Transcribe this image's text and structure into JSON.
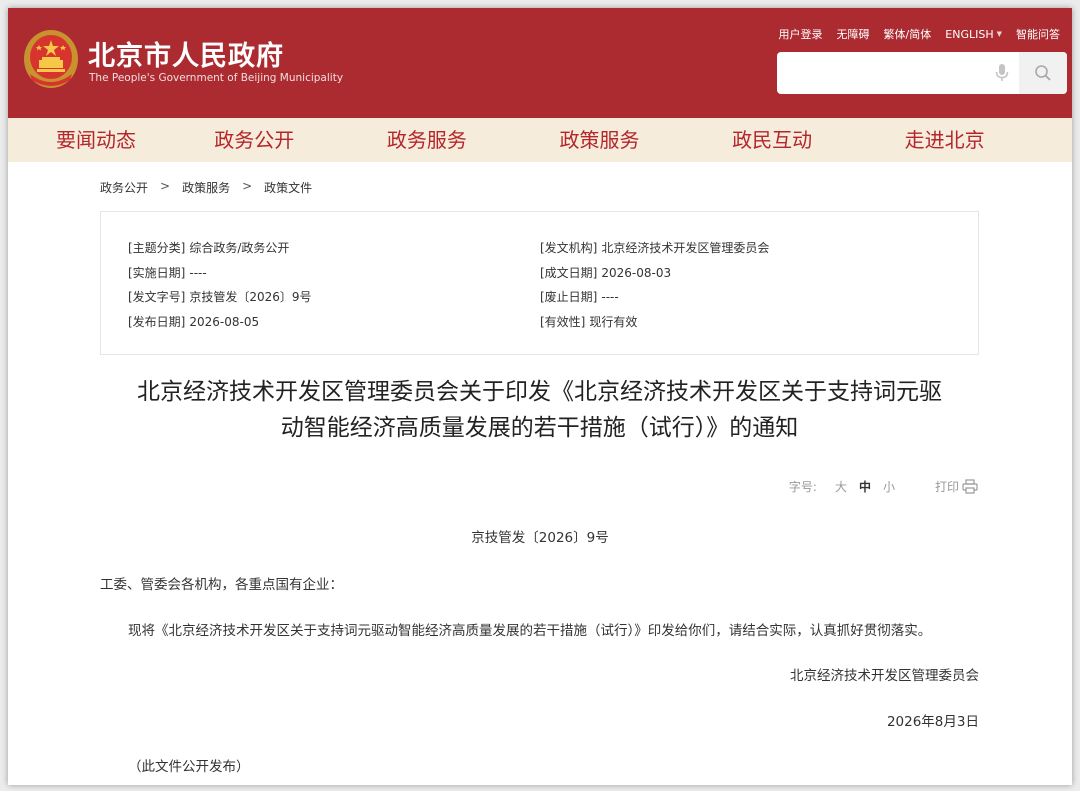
{
  "header": {
    "title": "北京市人民政府",
    "subtitle": "The People's Government of Beijing Municipality",
    "links": [
      "用户登录",
      "无障碍",
      "繁体/简体",
      "ENGLISH",
      "智能问答"
    ],
    "search_placeholder": ""
  },
  "nav": [
    "要闻动态",
    "政务公开",
    "政务服务",
    "政策服务",
    "政民互动",
    "走进北京"
  ],
  "breadcrumb": [
    "政务公开",
    "政策服务",
    "政策文件"
  ],
  "info": {
    "topic_k": "[主题分类]",
    "topic_v": "综合政务/政务公开",
    "org_k": "[发文机构]",
    "org_v": "北京经济技术开发区管理委员会",
    "impl_k": "[实施日期]",
    "impl_v": "----",
    "created_k": "[成文日期]",
    "created_v": "2026-08-03",
    "num_k": "[发文字号]",
    "num_v": "京技管发〔2026〕9号",
    "abolish_k": "[废止日期]",
    "abolish_v": "----",
    "pub_k": "[发布日期]",
    "pub_v": "2026-08-05",
    "valid_k": "[有效性]",
    "valid_v": "现行有效"
  },
  "doc": {
    "title_line1": "北京经济技术开发区管理委员会关于印发《北京经济技术开发区关于支持词元驱",
    "title_line2": "动智能经济高质量发展的若干措施（试行）》的通知",
    "font_label": "字号:",
    "font_large": "大",
    "font_medium": "中",
    "font_small": "小",
    "print_label": "打印",
    "doc_number": "京技管发〔2026〕9号",
    "recipients": "工委、管委会各机构，各重点国有企业：",
    "paragraph": "现将《北京经济技术开发区关于支持词元驱动智能经济高质量发展的若干措施（试行）》印发给你们，请结合实际，认真抓好贯彻落实。",
    "signature": "北京经济技术开发区管理委员会",
    "date": "2026年8月3日",
    "note": "（此文件公开发布）"
  },
  "colors": {
    "header_bg": "#ab2b31",
    "nav_bg": "#f6ecdb",
    "nav_text": "#b5262c"
  }
}
